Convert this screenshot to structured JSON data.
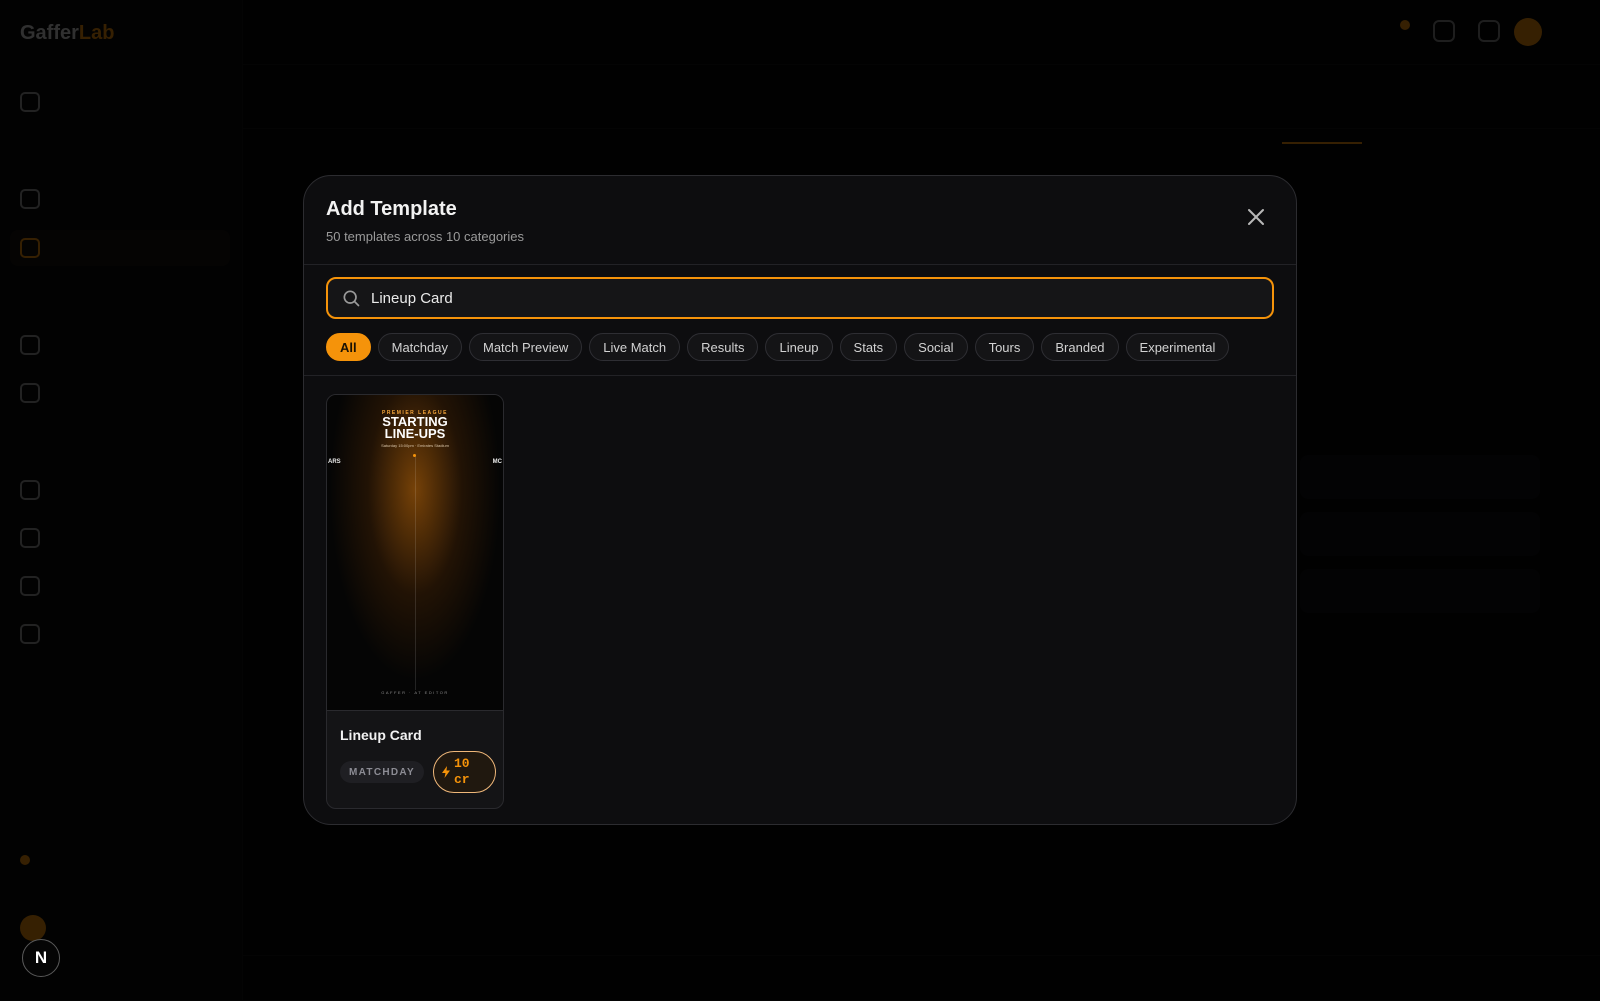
{
  "modal": {
    "title": "Add Template",
    "subtitle": "50 templates across 10 categories",
    "search": {
      "value": "Lineup Card"
    },
    "categories": [
      "All",
      "Matchday",
      "Match Preview",
      "Live Match",
      "Results",
      "Lineup",
      "Stats",
      "Social",
      "Tours",
      "Branded",
      "Experimental"
    ],
    "active_category": "All",
    "templates": [
      {
        "name": "Lineup Card",
        "category": "MATCHDAY",
        "cost": "10 cr",
        "preview": {
          "kicker": "PREMIER LEAGUE",
          "title_line1": "STARTING",
          "title_line2": "LINE-UPS",
          "meta": "Saturday 15:00pm · Emirates Stadium",
          "team_home": "ARS",
          "team_away": "MC",
          "footer": "GAFFER · AT EDITOR"
        }
      }
    ]
  },
  "badge": {
    "letter": "N"
  },
  "colors": {
    "accent": "#f5930a",
    "modal_bg": "#0d0d0f",
    "page_bg": "#050505"
  },
  "icons": {
    "search": "search-icon",
    "close": "close-icon",
    "bolt": "bolt-icon"
  }
}
